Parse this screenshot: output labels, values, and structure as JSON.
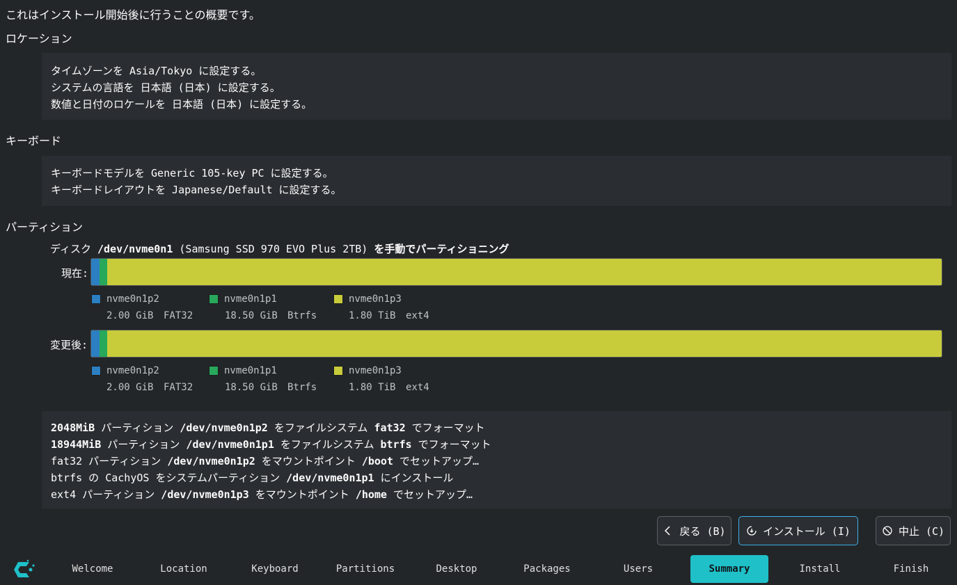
{
  "intro": "これはインストール開始後に行うことの概要です。",
  "location": {
    "title": "ロケーション",
    "lines": [
      "タイムゾーンを Asia/Tokyo に設定する。",
      "システムの言語を 日本語 (日本) に設定する。",
      "数値と日付のロケールを 日本語 (日本) に設定する。"
    ]
  },
  "keyboard": {
    "title": "キーボード",
    "lines": [
      "キーボードモデルを Generic 105-key PC に設定する。",
      "キーボードレイアウトを Japanese/Default に設定する。"
    ]
  },
  "partitions": {
    "title": "パーティション",
    "disk_prefix": "ディスク",
    "disk_path": "/dev/nvme0n1",
    "disk_model": "(Samsung SSD 970 EVO Plus 2TB)",
    "disk_suffix": "を手動でパーティショニング",
    "current_label": "現在:",
    "after_label": "変更後:",
    "legend": [
      {
        "name": "nvme0n1p2",
        "size": "2.00 GiB",
        "fs": "FAT32",
        "color": "#2c7fc0"
      },
      {
        "name": "nvme0n1p1",
        "size": "18.50 GiB",
        "fs": "Btrfs",
        "color": "#27a85a"
      },
      {
        "name": "nvme0n1p3",
        "size": "1.80 TiB",
        "fs": "ext4",
        "color": "#c8cc3a"
      }
    ],
    "bar_fraction": [
      0.0011,
      0.01,
      0.9889
    ],
    "operations": [
      {
        "a": "2048MiB",
        "b": " パーティション ",
        "c": "/dev/nvme0n1p2",
        "d": " をファイルシステム ",
        "e": "fat32",
        "f": " でフォーマット"
      },
      {
        "a": "18944MiB",
        "b": " パーティション ",
        "c": "/dev/nvme0n1p1",
        "d": " をファイルシステム ",
        "e": "btrfs",
        "f": " でフォーマット"
      },
      {
        "a": "fat32",
        "b": " パーティション ",
        "c": "/dev/nvme0n1p2",
        "d": " をマウントポイント ",
        "e": "/boot",
        "f": " でセットアップ…"
      },
      {
        "a": "btrfs",
        "b": " の CachyOS をシステムパーティション ",
        "c": "/dev/nvme0n1p1",
        "d": " にインストール",
        "e": "",
        "f": ""
      },
      {
        "a": "ext4",
        "b": " パーティション ",
        "c": "/dev/nvme0n1p3",
        "d": " をマウントポイント ",
        "e": "/home",
        "f": " でセットアップ…"
      }
    ]
  },
  "buttons": {
    "back": "戻る (B)",
    "install": "インストール (I)",
    "cancel": "中止 (C)"
  },
  "nav": [
    "Welcome",
    "Location",
    "Keyboard",
    "Partitions",
    "Desktop",
    "Packages",
    "Users",
    "Summary",
    "Install",
    "Finish"
  ],
  "nav_active": "Summary",
  "colors": {
    "background": "#232629",
    "panel": "#2a2e32",
    "accent": "#1fc0c8",
    "focus": "#3daee9"
  }
}
